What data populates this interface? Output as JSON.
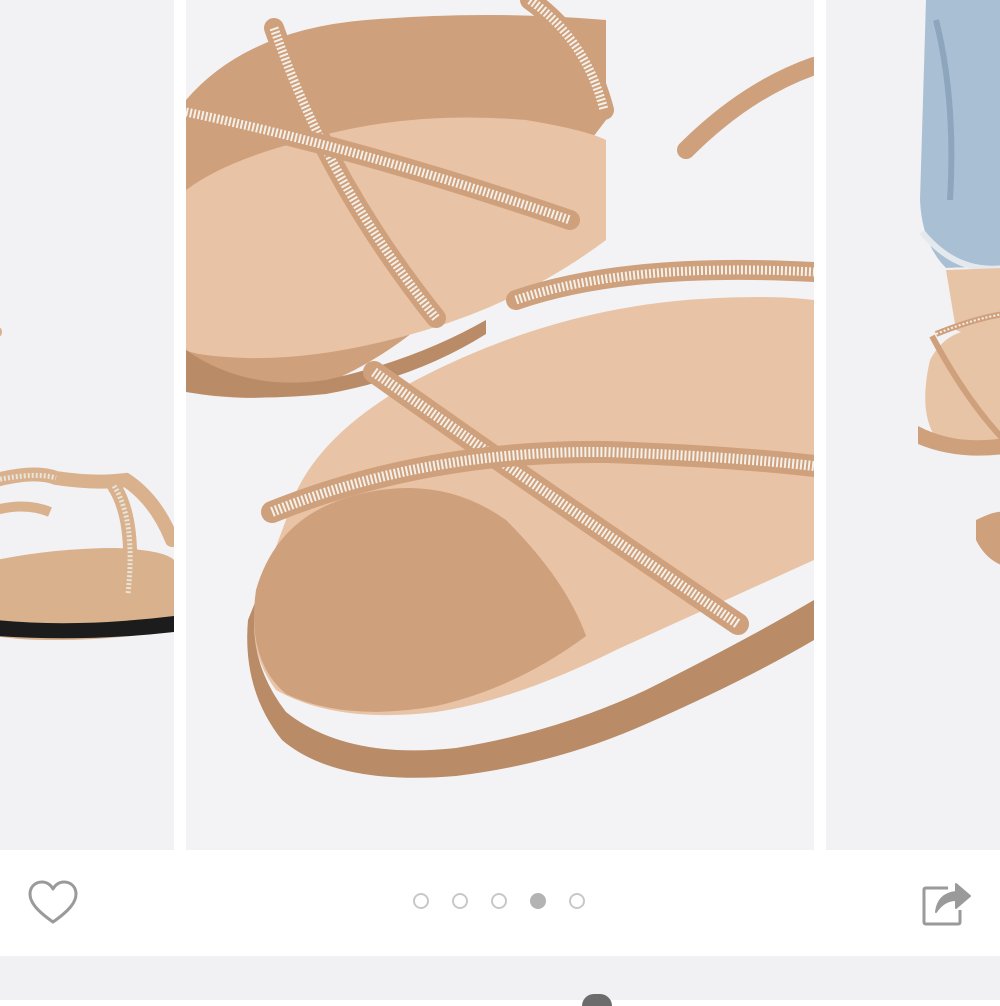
{
  "gallery": {
    "slides": [
      {
        "label": "",
        "description": ""
      },
      {
        "label": "",
        "description": ""
      },
      {
        "label": "",
        "description": ""
      }
    ],
    "pagination": {
      "total": 5,
      "active_index": 3
    }
  },
  "actions": {
    "favorite_icon": "heart-outline",
    "share_icon": "share-arrow"
  },
  "colors": {
    "background": "#ffffff",
    "slide_background": "#f3f3f5",
    "dot_inactive_border": "#c8c8c8",
    "dot_active": "#b3b3b3",
    "icon_stroke": "#9a9a9a",
    "bottom_strip": "#f1f1f3"
  }
}
